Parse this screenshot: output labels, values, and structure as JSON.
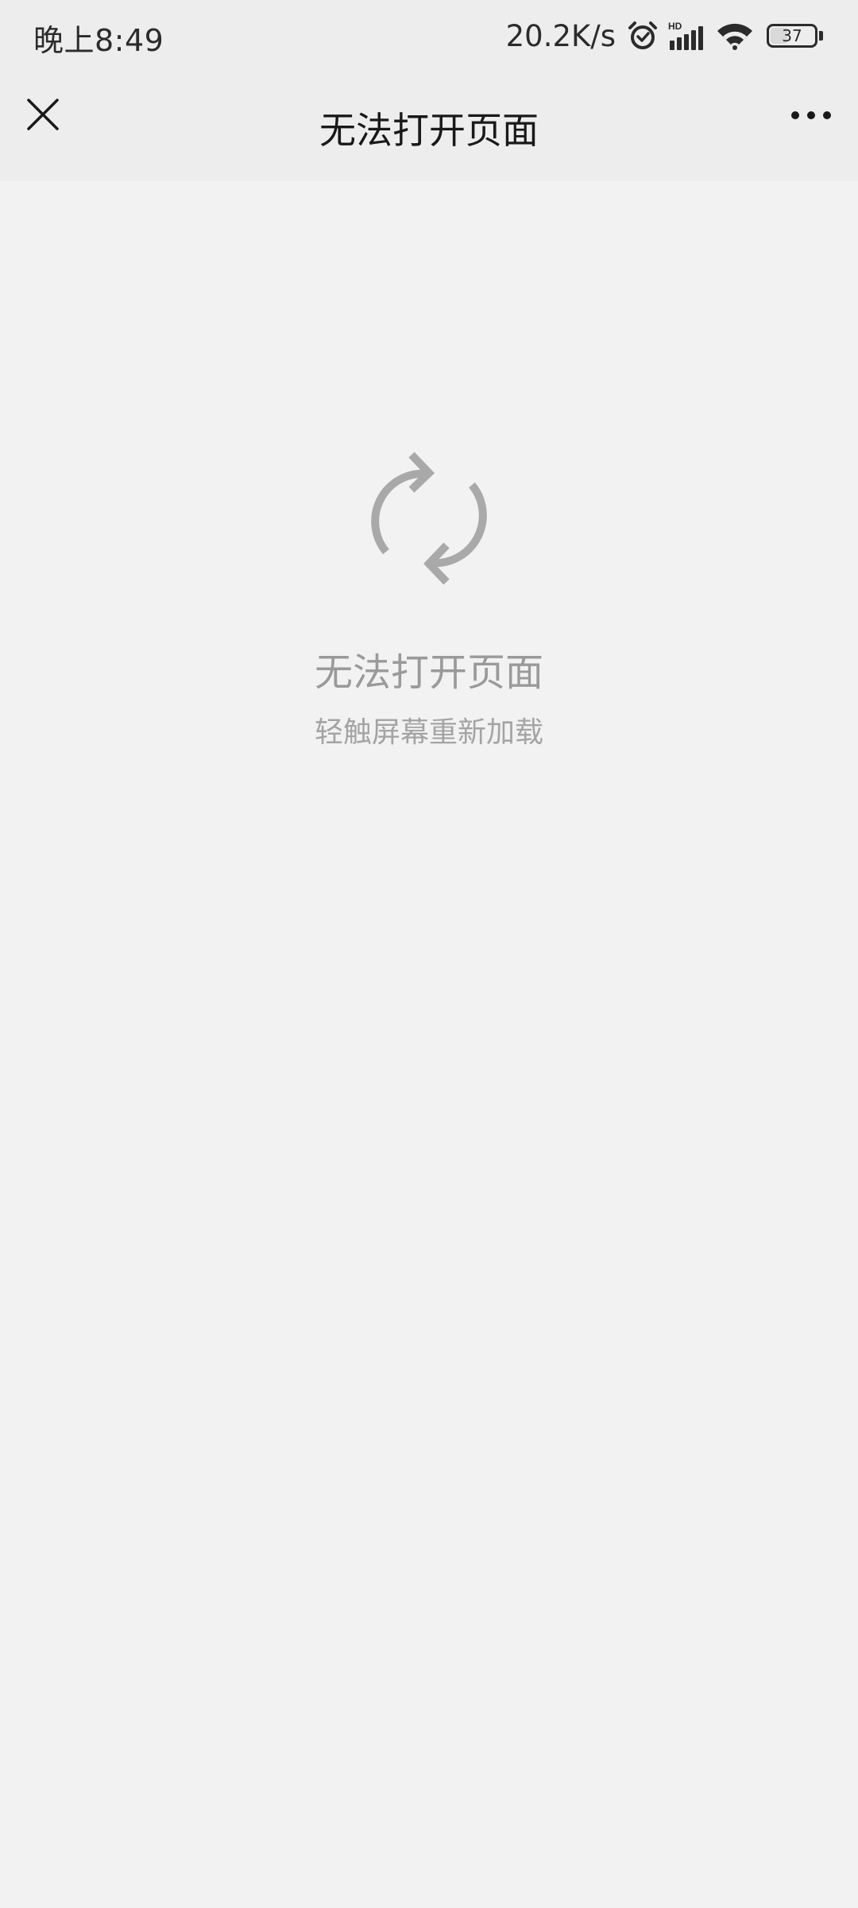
{
  "status_bar": {
    "time": "晚上8:49",
    "net_speed": "20.2K/s",
    "battery_level": "37",
    "icons": [
      "alarm-icon",
      "signal-hd-icon",
      "wifi-icon",
      "battery-icon"
    ]
  },
  "nav": {
    "title": "无法打开页面",
    "close_icon": "close-icon",
    "more_icon": "more-icon"
  },
  "error": {
    "icon": "refresh-icon",
    "title": "无法打开页面",
    "subtitle": "轻触屏幕重新加载"
  },
  "colors": {
    "page_background": "#f2f2f2",
    "bar_background": "#ededed",
    "icon_gray": "#a9a9a9",
    "title_text": "#191919"
  }
}
